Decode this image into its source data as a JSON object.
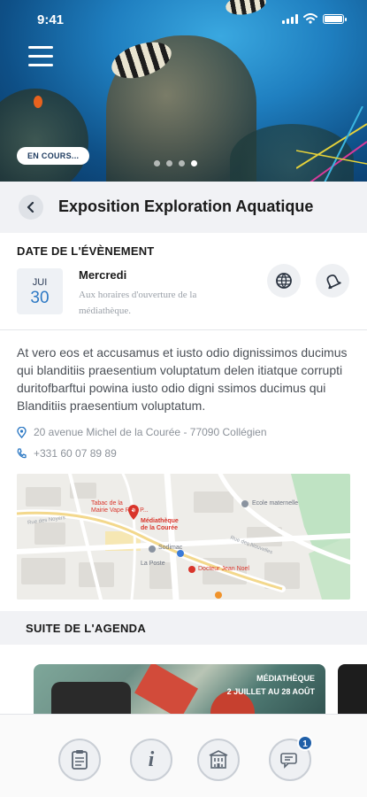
{
  "status_bar": {
    "time": "9:41"
  },
  "hero": {
    "status_label": "EN COURS...",
    "carousel": {
      "total": 4,
      "active_index": 3
    }
  },
  "header": {
    "title": "Exposition Exploration Aquatique"
  },
  "event_date": {
    "section_title": "DATE DE L'ÉVÈNEMENT",
    "month": "JUI",
    "day": "30",
    "weekday": "Mercredi",
    "hours_note": "Aux horaires d'ouverture de la médiathèque."
  },
  "description": "At vero eos et accusamus et iusto odio dignissimos ducimus qui blanditiis praesentium voluptatum delen itiatque corrupti duritofbarftui powina iusto odio digni ssimos ducimus qui Blanditiis praesentium voluptatum.",
  "contact": {
    "address": "20 avenue Michel de la Courée - 77090 Collégien",
    "phone": "+331 60 07 89 89"
  },
  "map": {
    "labels": {
      "place1": "Tabac de la",
      "place1b": "Mairie Vape Relo P...",
      "main_poi": "Médiathèque",
      "main_poi_b": "de la Courée",
      "school": "Ecole maternelle",
      "doctor": "Docteur Jean Noel",
      "shop": "Sodimac",
      "poste": "La Poste",
      "street1": "Rue des Noyers",
      "street2": "Rue des Nouvelles"
    }
  },
  "agenda": {
    "section_title": "SUITE DE L'AGENDA",
    "card": {
      "category": "MÉDIATHÈQUE",
      "dates": "2 JUILLET AU 28 AOÛT"
    }
  },
  "tabbar": {
    "tabs": [
      {
        "icon": "agenda-icon"
      },
      {
        "icon": "info-icon",
        "glyph": "i"
      },
      {
        "icon": "building-icon"
      },
      {
        "icon": "chat-icon",
        "badge": "1"
      }
    ]
  },
  "colors": {
    "accent": "#2d79c4",
    "badge": "#1f5fa8",
    "pin": "#d9352b"
  }
}
